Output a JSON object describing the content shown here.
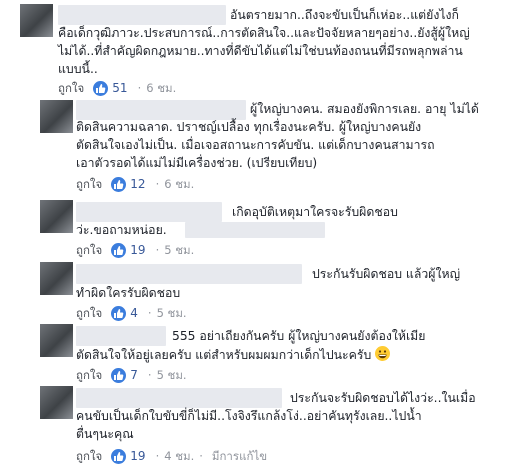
{
  "comments": [
    {
      "lines": [
        "อันตรายมาก..ถึงจะขับเป็นก็เห่อะ..แต่ยังไงก็",
        "คือเด็กวุฒิภาวะ.ประสบการณ์..การตัดสินใจ..และปัจจัยหลายๆอย่าง..ยังสู้ผู้ใหญ่",
        "ไม่ได้..ที่สำคัญผิดกฎหมาย..ทางที่ดีขับได้แต่ไม่ใช่บนท้องถนนที่มีรถพลุกพล่าน",
        "แบบนี้.."
      ],
      "like": "ถูกใจ",
      "count": "51",
      "time": "6 ชม."
    },
    {
      "lines": [
        "ผู้ใหญ่บางคน. สมองยังพิการเลย. อายุ ไม่ได้",
        "ติดสินความฉลาด. ปราชญ์เปลื้อง ทุกเรื่องนะครับ. ผู้ใหญ่บางคนยัง",
        "ตัดสินใจเองไม่เป็น. เมื่อเจอสถานะการคับขัน. แต่เด็กบางคนสามารถ",
        "เอาตัวรอดได้แม่ไม่มีเครื่องช่วย. (เปรียบเทียบ)"
      ],
      "like": "ถูกใจ",
      "count": "12",
      "time": "6 ชม."
    },
    {
      "lines": [
        "เกิดอุบัติเหตุมาใครจะรับผิดชอบ",
        "ว่ะ.ขอถามหน่อย."
      ],
      "like": "ถูกใจ",
      "count": "19",
      "time": "5 ชม."
    },
    {
      "lines": [
        "ประกันรับผิดชอบ แล้วผู้ใหญ่",
        "ทำผิดใครรับผิดชอบ"
      ],
      "like": "ถูกใจ",
      "count": "4",
      "time": "5 ชม."
    },
    {
      "lines": [
        "555 อย่าเถียงกันครับ ผู้ใหญ่บางคนยังต้องให้เมีย",
        "ตัดสินใจให้อยู่เลยครับ แต่สำหรับผมผมกว่าเด็กไปนะครับ"
      ],
      "like": "ถูกใจ",
      "count": "7",
      "time": "5 ชม."
    },
    {
      "lines": [
        "ประกันจะรับผิดชอบได้ไงว่ะ..ในเมื่อ",
        "คนขับเป็นเด็กใบขับขี่ก็ไม่มี..โงจิงรึแกล้งโง่..อย่าคันทุรังเลย..ไปน้ำ",
        "ตื่นๆนะคุณ"
      ],
      "like": "ถูกใจ",
      "count": "19",
      "time": "4 ชม.",
      "edited": "มีการแก้ไข"
    }
  ],
  "ui": {
    "dot": "·",
    "like_color": "#3b7ddd"
  }
}
